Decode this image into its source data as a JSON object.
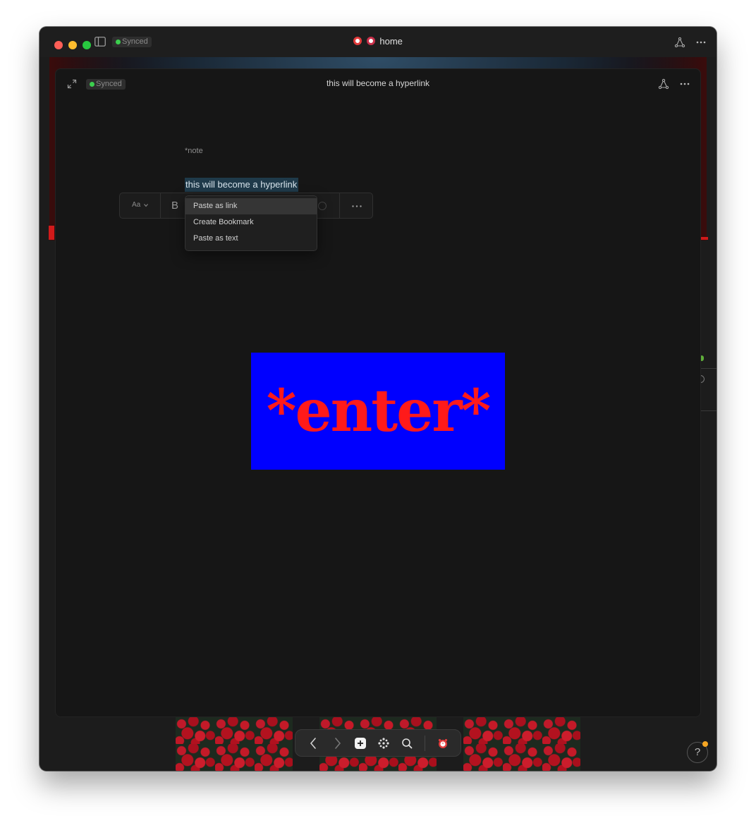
{
  "window": {
    "sync_status": "Synced",
    "title": "home",
    "title_icons": [
      "alarm-clock-icon",
      "heart-icon"
    ]
  },
  "panel": {
    "sync_status": "Synced",
    "title": "this will become a hyperlink"
  },
  "document": {
    "note_tag": "*note",
    "selected_text": "this will become a hyperlink"
  },
  "toolbar": {
    "text_style_label": "Aa",
    "bold_label": "B"
  },
  "paste_menu": {
    "items": [
      {
        "label": "Paste as link",
        "active": true
      },
      {
        "label": "Create Bookmark",
        "active": false
      },
      {
        "label": "Paste as text",
        "active": false
      }
    ]
  },
  "image": {
    "text": "*enter*",
    "background": "#0000ff",
    "text_color": "#ff1a1a"
  },
  "help": {
    "label": "?"
  },
  "colors": {
    "sync_dot": "#3ccf4e",
    "selection": "#1f3a4a",
    "notification": "#f5a623"
  }
}
